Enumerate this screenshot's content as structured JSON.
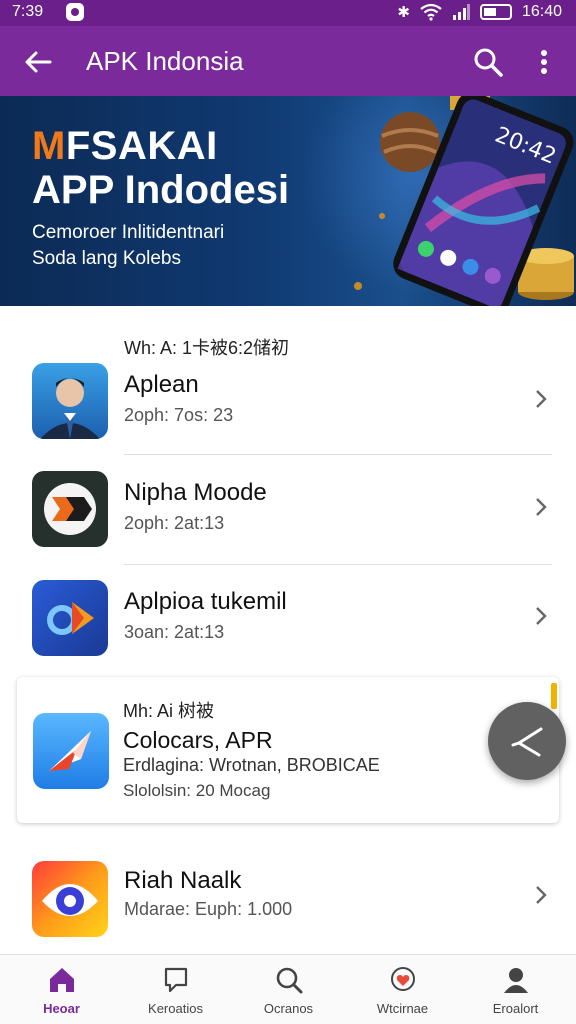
{
  "status_bar": {
    "time": "7:39",
    "clock_right": "16:40"
  },
  "app_bar": {
    "title": "APK Indonsia"
  },
  "banner": {
    "headline_accent": "M",
    "headline_rest": "FSAKAI",
    "headline2": "APP Indodesi",
    "sub1": "Cemoroer Inlitidentnari",
    "sub2": "Soda lang Kolebs",
    "phone_time": "20:42"
  },
  "section_label": "Wh: A: 1卡被6:2储初",
  "apps": [
    {
      "name": "Aplean",
      "meta": "2oph: 7os: 23"
    },
    {
      "name": "Nipha Moode",
      "meta": "2oph: 2at:13"
    },
    {
      "name": "Aplpioa tukemil",
      "meta": "3oan: 2at:13"
    }
  ],
  "featured": {
    "label": "Mh: Ai 树被",
    "name": "Colocars, APR",
    "line1": "Erdlagina: Wrotnan, BROBICAE",
    "line2": "Slololsin: 20 Mocag"
  },
  "last_app": {
    "name": "Riah Naalk",
    "meta": "Mdarae: Euph: 1.000"
  },
  "bottom_nav": [
    {
      "label": "Heoar",
      "icon": "home-icon",
      "active": true
    },
    {
      "label": "Keroatios",
      "icon": "bookmark-icon",
      "active": false
    },
    {
      "label": "Ocranos",
      "icon": "search-icon",
      "active": false
    },
    {
      "label": "Wtcirnae",
      "icon": "location-heart-icon",
      "active": false
    },
    {
      "label": "Eroalort",
      "icon": "profile-icon",
      "active": false
    }
  ],
  "colors": {
    "primary": "#7b2a9c",
    "status": "#6a1f8a",
    "banner": "#103a72",
    "accent": "#f07a1a"
  }
}
